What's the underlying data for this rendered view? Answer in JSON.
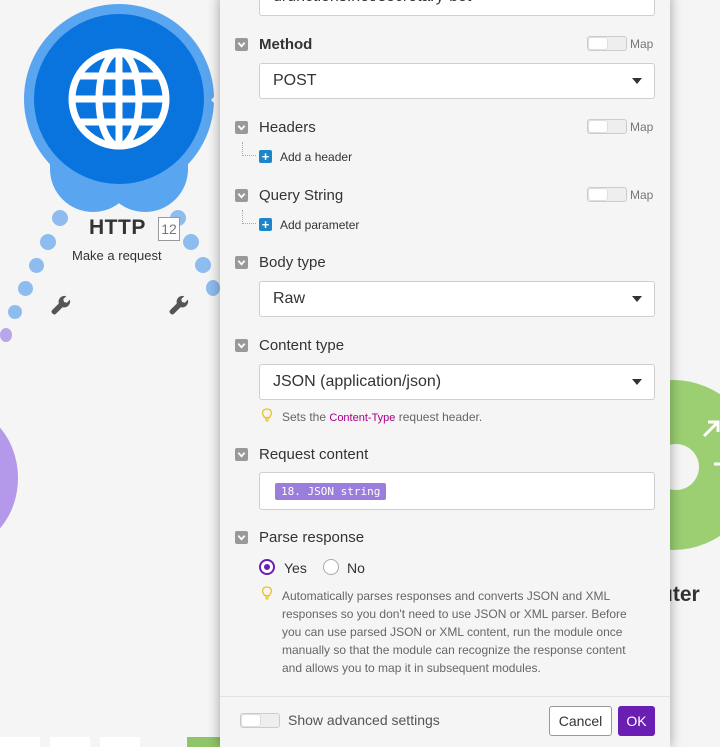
{
  "canvas": {
    "http_module": {
      "title": "HTTP",
      "badge": "12",
      "subtitle": "Make a request",
      "icon": "globe-icon"
    },
    "router_module": {
      "label": "uter"
    }
  },
  "panel": {
    "url_value": "drunctions.net/secretary-bot",
    "map_label": "Map",
    "method": {
      "label": "Method",
      "value": "POST"
    },
    "headers": {
      "label": "Headers",
      "add_label": "Add a header"
    },
    "query_string": {
      "label": "Query String",
      "add_label": "Add parameter"
    },
    "body_type": {
      "label": "Body type",
      "value": "Raw"
    },
    "content_type": {
      "label": "Content type",
      "value": "JSON (application/json)",
      "hint_prefix": "Sets the",
      "hint_code": "Content-Type",
      "hint_suffix": "request header."
    },
    "request_content": {
      "label": "Request content",
      "pill": "18. JSON string"
    },
    "parse_response": {
      "label": "Parse response",
      "options": [
        "Yes",
        "No"
      ],
      "selected": "Yes",
      "hint_lines": [
        "Automatically parses responses and converts JSON and XML",
        "responses so you don't need to use JSON or XML parser. Before",
        "you can use parsed JSON or XML content, run the module once",
        "manually so that the module can recognize the response content",
        "and allows you to map it in subsequent modules."
      ]
    },
    "footer": {
      "advanced_label": "Show advanced settings",
      "cancel_label": "Cancel",
      "ok_label": "OK"
    }
  },
  "colors": {
    "accent": "#6b1eb4",
    "http_blue": "#0a74de",
    "router_green": "#9bcf72",
    "pill_purple": "#9b7ddb",
    "add_blue": "#1b86c9"
  }
}
